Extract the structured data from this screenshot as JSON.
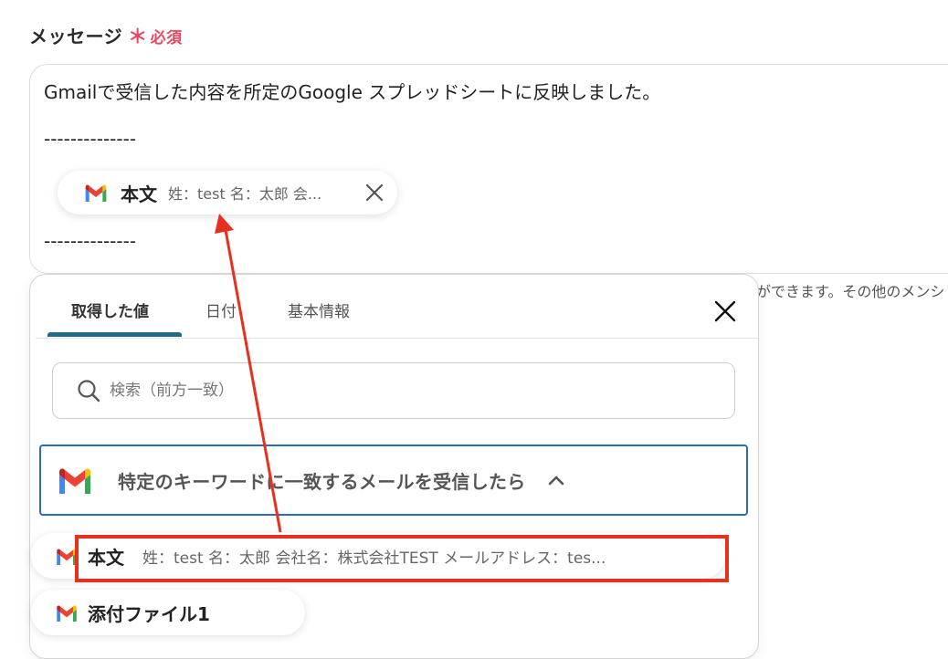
{
  "field": {
    "label": "メッセージ",
    "required_star": "＊",
    "required_text": "必須"
  },
  "message": {
    "line1": "Gmailで受信した内容を所定のGoogle スプレッドシートに反映しました。",
    "divider_top": "--------------",
    "divider_bottom": "--------------",
    "chip": {
      "icon": "gmail-icon",
      "title": "本文",
      "preview": "姓：test 名：太郎 会..."
    }
  },
  "hint_text": "ができます。その他のメンシ",
  "picker": {
    "tabs": [
      {
        "label": "取得した値",
        "active": true
      },
      {
        "label": "日付",
        "active": false
      },
      {
        "label": "基本情報",
        "active": false
      }
    ],
    "search": {
      "placeholder": "検索（前方一致）",
      "value": ""
    },
    "trigger": {
      "icon": "gmail-icon",
      "label": "特定のキーワードに一致するメールを受信したら",
      "expanded": true
    },
    "items": [
      {
        "icon": "gmail-icon",
        "title": "本文",
        "preview": "姓：test 名：太郎 会社名：株式会社TEST メールアドレス：tes..."
      },
      {
        "icon": "gmail-icon",
        "title": "添付ファイル1",
        "preview": ""
      }
    ]
  },
  "colors": {
    "accent_tab": "#1f6c84",
    "trigger_border": "#2b6db5",
    "required": "#e8475f",
    "annotation": "#e8301e",
    "gmail_red": "#ea4335",
    "gmail_blue": "#4285f4",
    "gmail_green": "#34a853",
    "gmail_yellow": "#fbbc04",
    "gmail_darkred": "#c5221f"
  }
}
